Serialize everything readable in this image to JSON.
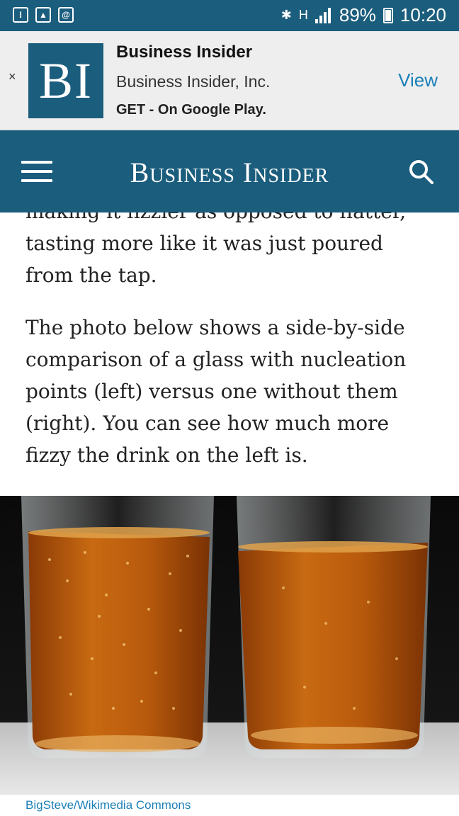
{
  "status_bar": {
    "battery": "89%",
    "time": "10:20",
    "network": "H"
  },
  "ad": {
    "close_label": "×",
    "logo_text": "BI",
    "title": "Business Insider",
    "company": "Business Insider, Inc.",
    "cta": "GET - On Google Play.",
    "view_label": "View"
  },
  "header": {
    "title": "Business Insider"
  },
  "article": {
    "paragraph_1": "making it fizzier as opposed to flatter, tasting more like it was just poured from the tap.",
    "paragraph_2": "The photo below shows a side-by-side comparison of a glass with nucleation points (left) versus one without them (right). You can see how much more fizzy the drink on the left is.",
    "photo_caption": "BigSteve/Wikimedia Commons"
  },
  "colors": {
    "brand": "#1b5d7d",
    "link": "#1b7fb8"
  }
}
